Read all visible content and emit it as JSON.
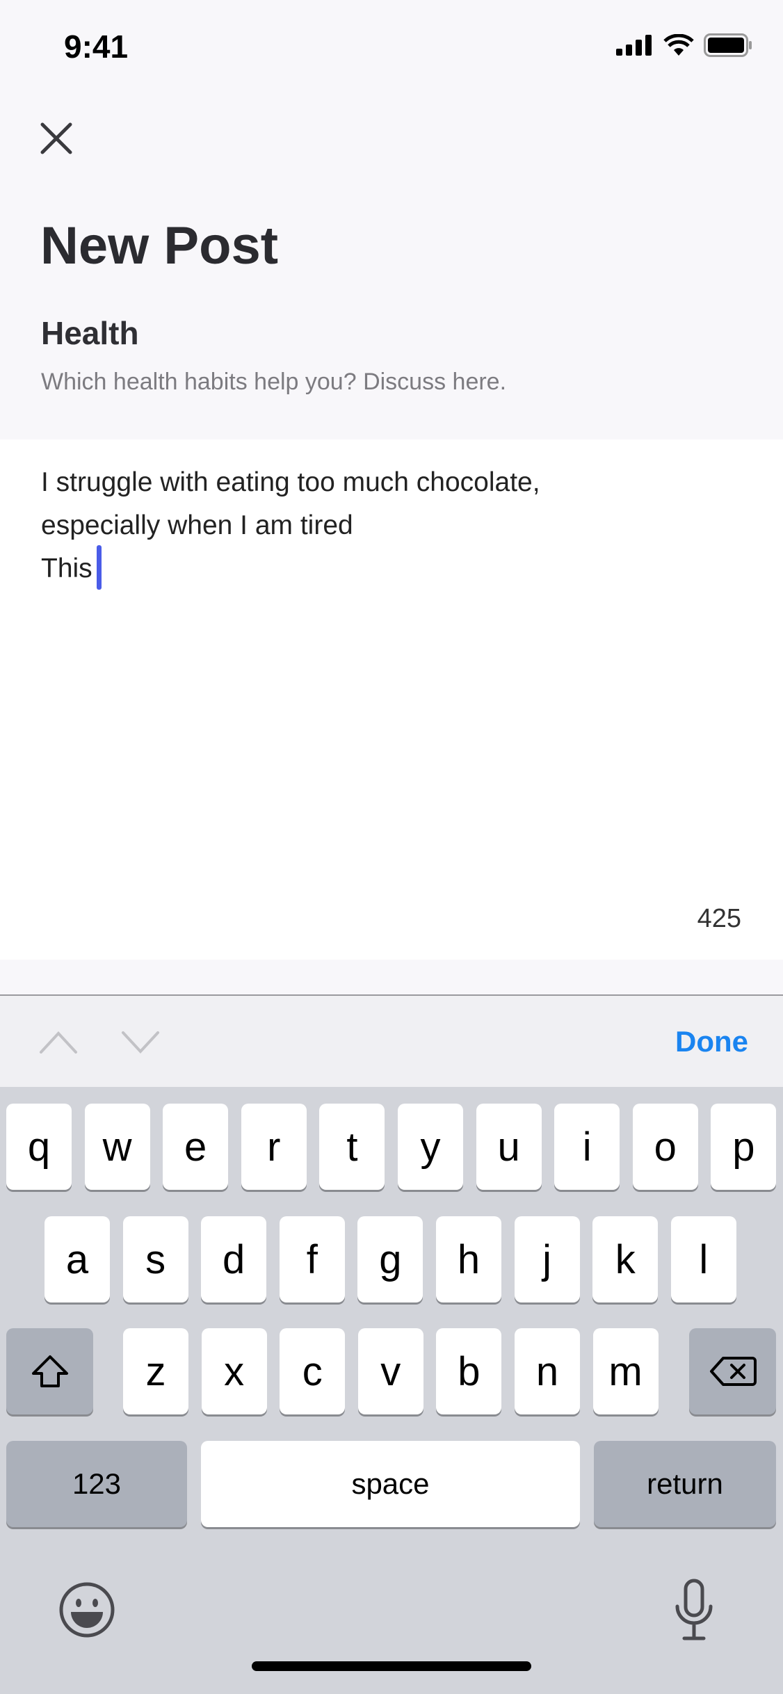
{
  "status_bar": {
    "time": "9:41",
    "icons": [
      "signal-icon",
      "wifi-icon",
      "battery-icon"
    ]
  },
  "header": {
    "close_icon": "close-icon",
    "title": "New Post",
    "category": "Health",
    "category_description": "Which health habits help you? Discuss here."
  },
  "editor": {
    "lines": [
      "I struggle with eating too much chocolate,",
      "especially when I am tired",
      "This"
    ],
    "char_count": "425"
  },
  "toolbar": {
    "prev_icon": "chevron-up-icon",
    "next_icon": "chevron-down-icon",
    "done_label": "Done"
  },
  "keyboard": {
    "row1": [
      "q",
      "w",
      "e",
      "r",
      "t",
      "y",
      "u",
      "i",
      "o",
      "p"
    ],
    "row2": [
      "a",
      "s",
      "d",
      "f",
      "g",
      "h",
      "j",
      "k",
      "l"
    ],
    "row3": [
      "z",
      "x",
      "c",
      "v",
      "b",
      "n",
      "m"
    ],
    "numbers_label": "123",
    "space_label": "space",
    "return_label": "return",
    "icons": [
      "shift-icon",
      "delete-icon",
      "emoji-icon",
      "microphone-icon"
    ]
  },
  "colors": {
    "accent": "#1a84f0",
    "cursor": "#4a5ce8"
  }
}
